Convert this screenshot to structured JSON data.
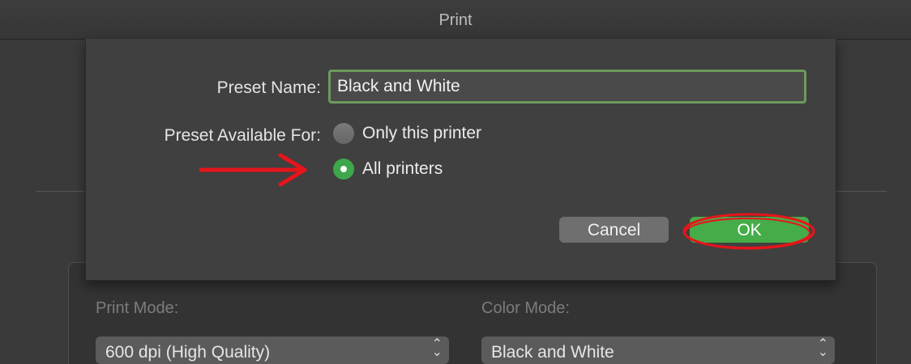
{
  "window": {
    "title": "Print"
  },
  "preset_dialog": {
    "name_label": "Preset Name:",
    "name_value": "Black and White",
    "available_label": "Preset Available For:",
    "options": [
      {
        "label": "Only this printer",
        "selected": false
      },
      {
        "label": "All printers",
        "selected": true
      }
    ],
    "cancel_label": "Cancel",
    "ok_label": "OK"
  },
  "background_panel": {
    "print_mode_label": "Print Mode:",
    "print_mode_value": "600 dpi (High Quality)",
    "color_mode_label": "Color Mode:",
    "color_mode_value": "Black and White"
  },
  "colors": {
    "accent_green": "#45ac49",
    "annotation_red": "#e8141b",
    "focus_ring": "#6c9a5c"
  },
  "annotations": {
    "arrow": "red-arrow-pointing-right",
    "highlight": "red-ellipse-around-ok"
  }
}
